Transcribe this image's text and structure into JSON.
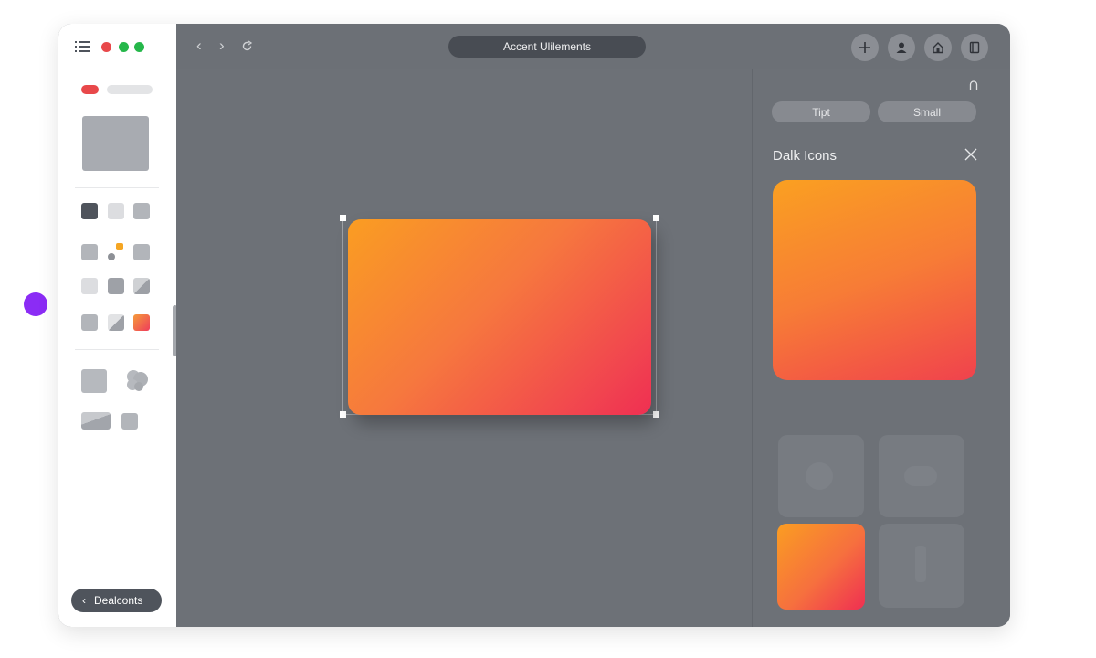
{
  "window": {
    "title": "Accent Ulilements",
    "traffic_lights": [
      "#e8484a",
      "#25b74a",
      "#25b74a"
    ]
  },
  "sidebar": {
    "accent_pill_color": "#e8484a",
    "back_button_label": "Dealconts"
  },
  "topbar": {
    "nav": [
      "chevron-left-icon",
      "chevron-right-icon",
      "refresh-icon"
    ],
    "actions": [
      "plus-icon",
      "user-icon",
      "home-icon",
      "book-icon"
    ]
  },
  "canvas": {
    "selected_card_gradient": [
      "#fa9d22",
      "#ef2f52"
    ]
  },
  "panel": {
    "segments": [
      "Tipt",
      "Small"
    ],
    "title": "Dalk Icons",
    "swatch_gradient": [
      "#faa021",
      "#f0424d"
    ]
  },
  "accent_dot_color": "#8b2cf5"
}
